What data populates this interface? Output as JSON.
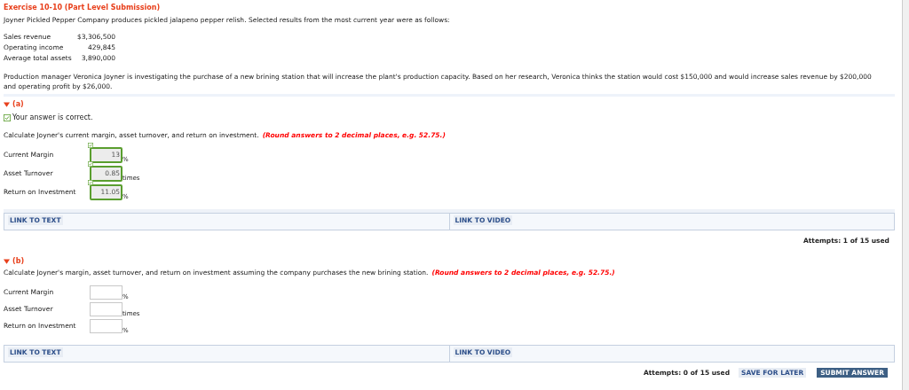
{
  "title": "Exercise 10-10 (Part Level Submission)",
  "intro": "Joyner Pickled Pepper Company produces pickled jalapeno pepper relish. Selected results from the most current year were as follows:",
  "financials": [
    {
      "label": "Sales revenue",
      "value": "$3,306,500"
    },
    {
      "label": "Operating income",
      "value": "429,845"
    },
    {
      "label": "Average total assets",
      "value": "3,890,000"
    }
  ],
  "paragraph": "Production manager Veronica Joyner is investigating the purchase of a new brining station that will increase the plant's production capacity. Based on her research, Veronica thinks the station would cost $150,000 and would increase sales revenue by $200,000 and operating profit by $26,000.",
  "parts": [
    {
      "label": "(a)",
      "expanded": true,
      "feedback": "Your answer is correct.",
      "instruction": "Calculate Joyner's current margin, asset turnover, and return on investment.",
      "note": "(Round answers to 2 decimal places, e.g. 52.75.)",
      "fields": [
        {
          "label": "Current Margin",
          "value": "13",
          "unit": "%",
          "correct": true
        },
        {
          "label": "Asset Turnover",
          "value": "0.85",
          "unit": "times",
          "correct": true
        },
        {
          "label": "Return on Investment",
          "value": "11.05",
          "unit": "%",
          "correct": true
        }
      ],
      "links": [
        "LINK TO TEXT",
        "LINK TO VIDEO"
      ],
      "attempts": "Attempts: 1 of 15 used"
    },
    {
      "label": "(b)",
      "expanded": true,
      "instruction": "Calculate Joyner's margin, asset turnover, and return on investment assuming the company purchases the new brining station.",
      "note": "(Round answers to 2 decimal places, e.g. 52.75.)",
      "fields": [
        {
          "label": "Current Margin",
          "unit": "%",
          "correct": false
        },
        {
          "label": "Asset Turnover",
          "unit": "times",
          "correct": false
        },
        {
          "label": "Return on Investment",
          "unit": "%",
          "correct": false
        }
      ],
      "links": [
        "LINK TO TEXT",
        "LINK TO VIDEO"
      ],
      "attempts": "Attempts: 0 of 15 used",
      "buttons": [
        {
          "label": "SAVE FOR LATER",
          "kind": "secondary"
        },
        {
          "label": "SUBMIT ANSWER",
          "kind": "primary"
        }
      ]
    }
  ]
}
